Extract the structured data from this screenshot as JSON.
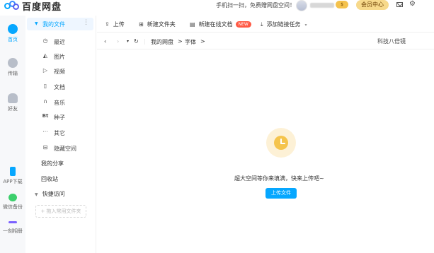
{
  "app": {
    "title": "百度网盘"
  },
  "header": {
    "promo": "手机扫一扫，免费赠网盘空间！",
    "member_center": "会员中心"
  },
  "rail": [
    {
      "key": "home",
      "label": "首页",
      "active": true
    },
    {
      "key": "transfer",
      "label": "传输",
      "active": false
    },
    {
      "key": "friends",
      "label": "好友",
      "active": false
    },
    {
      "key": "app_download",
      "label": "APP下载",
      "active": false
    },
    {
      "key": "wechat_backup",
      "label": "微信备份",
      "active": false
    },
    {
      "key": "one_click",
      "label": "一刻相册",
      "active": false
    }
  ],
  "nav": {
    "my_files": "我的文件",
    "more": "⋮",
    "sub": [
      {
        "icon": "clock-icon",
        "glyph": "◷",
        "label": "最近"
      },
      {
        "icon": "image-icon",
        "glyph": "◭",
        "label": "图片"
      },
      {
        "icon": "video-icon",
        "glyph": "▷",
        "label": "视频"
      },
      {
        "icon": "document-icon",
        "glyph": "▯",
        "label": "文档"
      },
      {
        "icon": "headphones-icon",
        "glyph": "∩",
        "label": "音乐"
      },
      {
        "icon": "torrent-icon",
        "glyph": "Bt",
        "label": "种子"
      },
      {
        "icon": "ellipsis-icon",
        "glyph": "···",
        "label": "其它"
      },
      {
        "icon": "lock-icon",
        "glyph": "⊟",
        "label": "隐藏空间"
      }
    ],
    "my_share": "我的分享",
    "recycle_bin": "回收站",
    "quick_access": "快捷访问",
    "add_quick": "+ 拖入常用文件夹"
  },
  "toolbar": {
    "upload": "上传",
    "new_folder": "新建文件夹",
    "new_online_doc": "新建在线文档",
    "new_badge": "NEW",
    "add_link_task": "添加链接任务"
  },
  "path": {
    "root": "我的网盘",
    "sep": ">",
    "current": "字体",
    "search_hint": "科技八倍镜"
  },
  "empty": {
    "message": "超大空间等你来填满，快来上传吧~",
    "upload_button": "上传文件"
  },
  "colors": {
    "accent": "#06a7ff",
    "member": "#f7d98b",
    "badge": "#ff5a45"
  }
}
